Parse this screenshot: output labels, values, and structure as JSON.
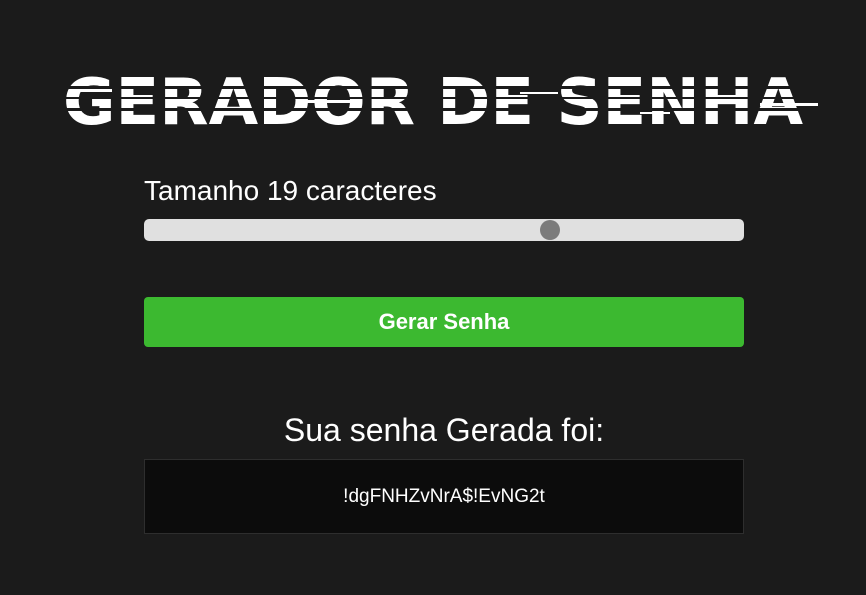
{
  "title": "GERADOR DE SENHA",
  "length": {
    "label": "Tamanho 19 caracteres",
    "value": 19,
    "min": 6,
    "max": 25
  },
  "generate_button": {
    "label": "Gerar Senha"
  },
  "result": {
    "heading": "Sua senha Gerada foi:",
    "password": "!dgFNHZvNrA$!EvNG2t"
  },
  "colors": {
    "background": "#1b1b1b",
    "button": "#3cb930",
    "track": "#e0e0e0",
    "thumb": "#7b7b7b",
    "password_box": "#0c0c0c"
  }
}
